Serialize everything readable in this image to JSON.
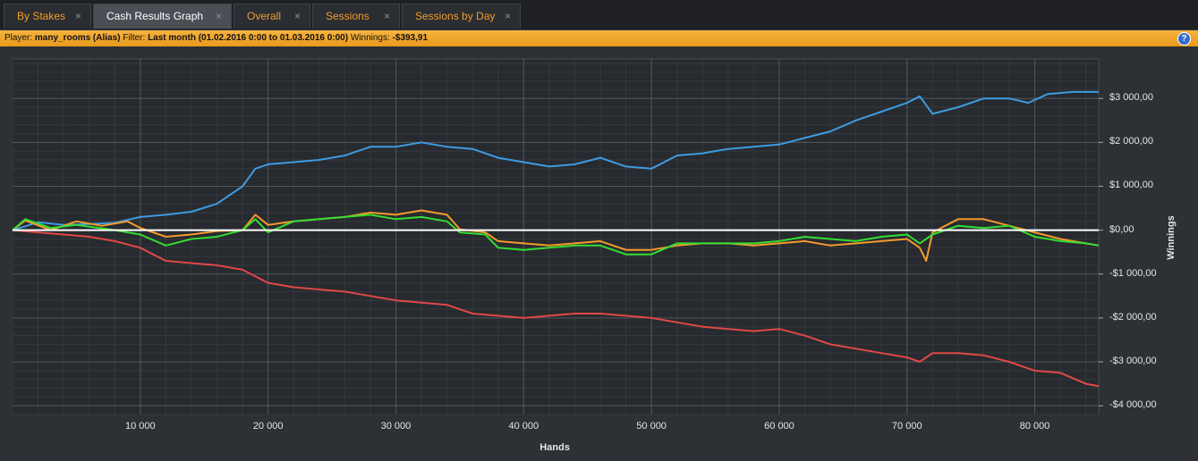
{
  "tabs": [
    {
      "label": "By Stakes",
      "active": false
    },
    {
      "label": "Cash Results Graph",
      "active": true
    },
    {
      "label": "Overall",
      "active": false
    },
    {
      "label": "Sessions",
      "active": false
    },
    {
      "label": "Sessions by Day",
      "active": false
    }
  ],
  "tab_close_glyph": "×",
  "filter": {
    "player_label": "Player:",
    "player_value": "many_rooms (Alias)",
    "filter_label": "Filter:",
    "filter_value": "Last month (01.02.2016 0:00 to 01.03.2016 0:00)",
    "winnings_label": "Winnings:",
    "winnings_value": "-$393,91",
    "help_glyph": "?"
  },
  "colors": {
    "blue": "#3e9be0",
    "orange": "#f39a2c",
    "green": "#33dd33",
    "red": "#e04848",
    "zero_line": "#ffffff",
    "tab_text": "#f39c2c",
    "filter_bar": "#f1a833"
  },
  "chart_data": {
    "type": "line",
    "xlabel": "Hands",
    "ylabel": "Winnings",
    "xlim": [
      0,
      85000
    ],
    "ylim": [
      -4200,
      3900
    ],
    "x_ticks": [
      10000,
      20000,
      30000,
      40000,
      50000,
      60000,
      70000,
      80000
    ],
    "x_tick_labels": [
      "10 000",
      "20 000",
      "30 000",
      "40 000",
      "50 000",
      "60 000",
      "70 000",
      "80 000"
    ],
    "y_ticks": [
      3000,
      2000,
      1000,
      0,
      -1000,
      -2000,
      -3000,
      -4000
    ],
    "y_tick_labels": [
      "$3 000,00",
      "$2 000,00",
      "$1 000,00",
      "$0,00",
      "-$1 000,00",
      "-$2 000,00",
      "-$3 000,00",
      "-$4 000,00"
    ],
    "grid": true,
    "series": [
      {
        "color": "#3e9be0",
        "points": [
          [
            0,
            0
          ],
          [
            2000,
            180
          ],
          [
            4000,
            120
          ],
          [
            6000,
            140
          ],
          [
            8000,
            170
          ],
          [
            10000,
            300
          ],
          [
            12000,
            350
          ],
          [
            14000,
            420
          ],
          [
            16000,
            600
          ],
          [
            18000,
            1000
          ],
          [
            19000,
            1400
          ],
          [
            20000,
            1500
          ],
          [
            22000,
            1550
          ],
          [
            24000,
            1600
          ],
          [
            26000,
            1700
          ],
          [
            28000,
            1900
          ],
          [
            30000,
            1900
          ],
          [
            32000,
            2000
          ],
          [
            34000,
            1900
          ],
          [
            36000,
            1850
          ],
          [
            38000,
            1650
          ],
          [
            40000,
            1550
          ],
          [
            42000,
            1450
          ],
          [
            44000,
            1500
          ],
          [
            46000,
            1650
          ],
          [
            48000,
            1450
          ],
          [
            50000,
            1400
          ],
          [
            52000,
            1700
          ],
          [
            54000,
            1750
          ],
          [
            56000,
            1850
          ],
          [
            58000,
            1900
          ],
          [
            60000,
            1950
          ],
          [
            62000,
            2100
          ],
          [
            64000,
            2250
          ],
          [
            66000,
            2500
          ],
          [
            68000,
            2700
          ],
          [
            70000,
            2900
          ],
          [
            71000,
            3050
          ],
          [
            72000,
            2650
          ],
          [
            74000,
            2800
          ],
          [
            76000,
            3000
          ],
          [
            78000,
            3000
          ],
          [
            79500,
            2900
          ],
          [
            81000,
            3100
          ],
          [
            83000,
            3150
          ],
          [
            85000,
            3150
          ]
        ]
      },
      {
        "color": "#f39a2c",
        "points": [
          [
            0,
            0
          ],
          [
            1000,
            220
          ],
          [
            3000,
            0
          ],
          [
            5000,
            200
          ],
          [
            7000,
            100
          ],
          [
            9000,
            200
          ],
          [
            10000,
            50
          ],
          [
            12000,
            -150
          ],
          [
            14000,
            -100
          ],
          [
            16000,
            -20
          ],
          [
            18000,
            0
          ],
          [
            19000,
            350
          ],
          [
            20000,
            120
          ],
          [
            22000,
            200
          ],
          [
            24000,
            250
          ],
          [
            26000,
            300
          ],
          [
            28000,
            400
          ],
          [
            30000,
            350
          ],
          [
            32000,
            450
          ],
          [
            34000,
            350
          ],
          [
            35000,
            20
          ],
          [
            37000,
            -50
          ],
          [
            38000,
            -250
          ],
          [
            40000,
            -300
          ],
          [
            42000,
            -350
          ],
          [
            44000,
            -300
          ],
          [
            46000,
            -250
          ],
          [
            48000,
            -450
          ],
          [
            50000,
            -450
          ],
          [
            52000,
            -350
          ],
          [
            54000,
            -300
          ],
          [
            56000,
            -300
          ],
          [
            58000,
            -350
          ],
          [
            60000,
            -300
          ],
          [
            62000,
            -250
          ],
          [
            64000,
            -350
          ],
          [
            66000,
            -300
          ],
          [
            68000,
            -250
          ],
          [
            70000,
            -200
          ],
          [
            71000,
            -400
          ],
          [
            71500,
            -700
          ],
          [
            72000,
            -50
          ],
          [
            74000,
            250
          ],
          [
            76000,
            250
          ],
          [
            78000,
            100
          ],
          [
            80000,
            -50
          ],
          [
            82000,
            -200
          ],
          [
            84000,
            -300
          ],
          [
            85000,
            -350
          ]
        ]
      },
      {
        "color": "#33dd33",
        "points": [
          [
            0,
            0
          ],
          [
            1000,
            250
          ],
          [
            3000,
            50
          ],
          [
            5000,
            120
          ],
          [
            8000,
            0
          ],
          [
            10000,
            -100
          ],
          [
            12000,
            -350
          ],
          [
            14000,
            -200
          ],
          [
            16000,
            -150
          ],
          [
            18000,
            0
          ],
          [
            19000,
            250
          ],
          [
            20000,
            -50
          ],
          [
            22000,
            200
          ],
          [
            24000,
            250
          ],
          [
            26000,
            300
          ],
          [
            28000,
            350
          ],
          [
            30000,
            250
          ],
          [
            32000,
            300
          ],
          [
            34000,
            200
          ],
          [
            35000,
            -50
          ],
          [
            37000,
            -100
          ],
          [
            38000,
            -400
          ],
          [
            40000,
            -450
          ],
          [
            42000,
            -400
          ],
          [
            44000,
            -350
          ],
          [
            46000,
            -350
          ],
          [
            48000,
            -550
          ],
          [
            50000,
            -550
          ],
          [
            52000,
            -300
          ],
          [
            54000,
            -300
          ],
          [
            56000,
            -300
          ],
          [
            58000,
            -300
          ],
          [
            60000,
            -250
          ],
          [
            62000,
            -150
          ],
          [
            64000,
            -200
          ],
          [
            66000,
            -250
          ],
          [
            68000,
            -150
          ],
          [
            70000,
            -100
          ],
          [
            71000,
            -300
          ],
          [
            72000,
            -100
          ],
          [
            74000,
            100
          ],
          [
            76000,
            50
          ],
          [
            78000,
            100
          ],
          [
            80000,
            -150
          ],
          [
            82000,
            -250
          ],
          [
            84000,
            -300
          ],
          [
            85000,
            -350
          ]
        ]
      },
      {
        "color": "#e04848",
        "points": [
          [
            0,
            0
          ],
          [
            2000,
            -50
          ],
          [
            4000,
            -100
          ],
          [
            6000,
            -150
          ],
          [
            8000,
            -250
          ],
          [
            10000,
            -400
          ],
          [
            12000,
            -700
          ],
          [
            14000,
            -750
          ],
          [
            16000,
            -800
          ],
          [
            18000,
            -900
          ],
          [
            20000,
            -1200
          ],
          [
            22000,
            -1300
          ],
          [
            24000,
            -1350
          ],
          [
            26000,
            -1400
          ],
          [
            28000,
            -1500
          ],
          [
            30000,
            -1600
          ],
          [
            32000,
            -1650
          ],
          [
            34000,
            -1700
          ],
          [
            36000,
            -1900
          ],
          [
            38000,
            -1950
          ],
          [
            40000,
            -2000
          ],
          [
            42000,
            -1950
          ],
          [
            44000,
            -1900
          ],
          [
            46000,
            -1900
          ],
          [
            48000,
            -1950
          ],
          [
            50000,
            -2000
          ],
          [
            52000,
            -2100
          ],
          [
            54000,
            -2200
          ],
          [
            56000,
            -2250
          ],
          [
            58000,
            -2300
          ],
          [
            60000,
            -2250
          ],
          [
            62000,
            -2400
          ],
          [
            64000,
            -2600
          ],
          [
            66000,
            -2700
          ],
          [
            68000,
            -2800
          ],
          [
            70000,
            -2900
          ],
          [
            71000,
            -3000
          ],
          [
            72000,
            -2800
          ],
          [
            74000,
            -2800
          ],
          [
            76000,
            -2850
          ],
          [
            78000,
            -3000
          ],
          [
            80000,
            -3200
          ],
          [
            82000,
            -3250
          ],
          [
            84000,
            -3500
          ],
          [
            85000,
            -3550
          ]
        ]
      }
    ]
  }
}
